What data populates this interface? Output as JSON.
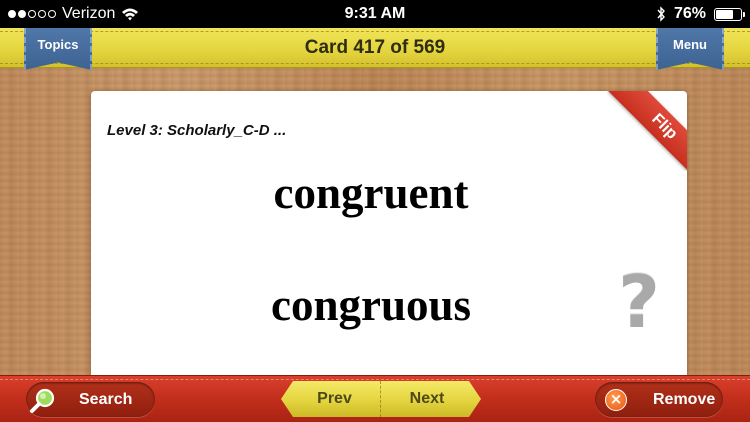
{
  "status_bar": {
    "carrier": "Verizon",
    "time": "9:31 AM",
    "battery_text": "76%",
    "battery_level": 0.76,
    "signal_bars_filled": 2,
    "signal_bars_total": 5
  },
  "header": {
    "title": "Card 417 of 569",
    "topics_label": "Topics",
    "menu_label": "Menu"
  },
  "card": {
    "topic": "Level 3: Scholarly_C-D ...",
    "term_primary": "congruent",
    "term_secondary": "congruous",
    "flip_label": "Flip",
    "help_glyph": "?"
  },
  "footer": {
    "search_label": "Search",
    "prev_label": "Prev",
    "next_label": "Next",
    "remove_label": "Remove",
    "remove_glyph": "×"
  },
  "icons": {
    "search": "search-icon",
    "remove": "close-icon",
    "help": "question-icon",
    "wifi": "wifi-icon",
    "bluetooth": "bluetooth-icon",
    "battery": "battery-icon"
  },
  "colors": {
    "header_yellow": "#e5d640",
    "ribbon_blue": "#4f77a8",
    "footer_red": "#c22e1c",
    "flip_red": "#d63d2c",
    "remove_orange": "#e8590f"
  }
}
